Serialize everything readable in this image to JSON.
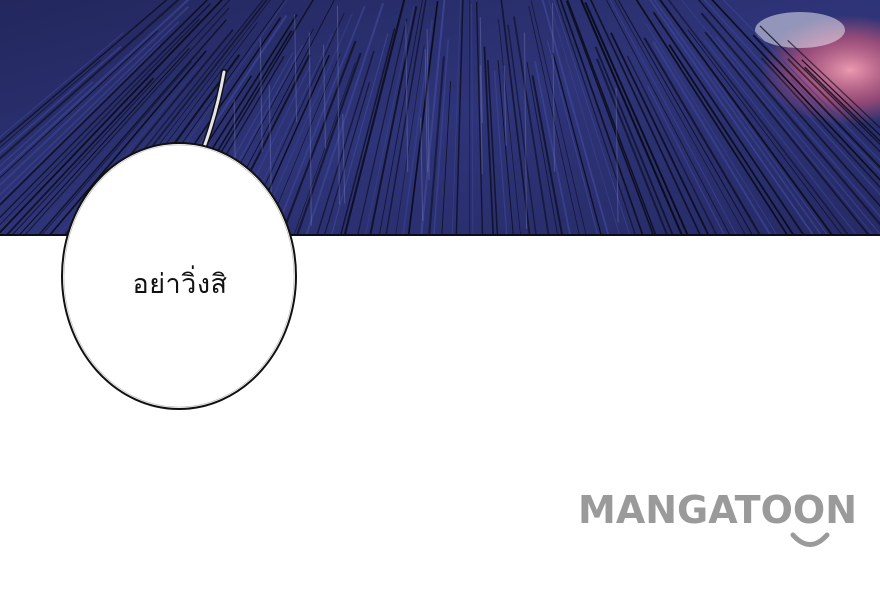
{
  "panel": {
    "background_color": "#2a2e6e",
    "line_color": "#0b0d1c",
    "accent_color": "#e8607a"
  },
  "speech_bubble": {
    "text": "อย่าวิ่งสิ",
    "fill_color": "#ffffff",
    "border_color": "#111111"
  },
  "watermark": {
    "text": "MANGATOON",
    "color": "#9a9a9a",
    "icon": "smile-icon"
  }
}
